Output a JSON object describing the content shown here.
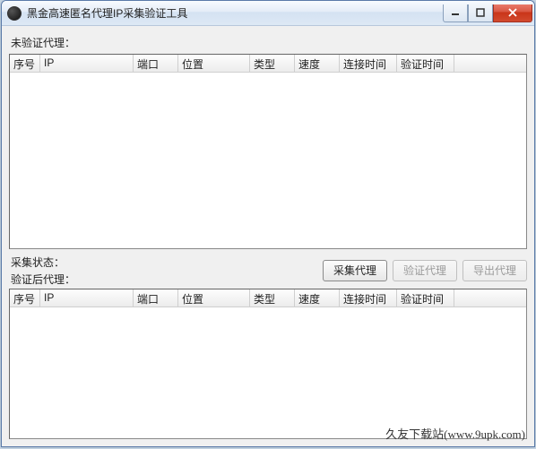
{
  "window": {
    "title": "黑金高速匿名代理IP采集验证工具"
  },
  "labels": {
    "unverified": "未验证代理：",
    "collect_status": "采集状态：",
    "verified": "验证后代理："
  },
  "columns": {
    "seq": "序号",
    "ip": "IP",
    "port": "端口",
    "location": "位置",
    "type": "类型",
    "speed": "速度",
    "connect_time": "连接时间",
    "verify_time": "验证时间"
  },
  "buttons": {
    "collect": "采集代理",
    "verify": "验证代理",
    "export": "导出代理"
  },
  "watermark": "久友下载站(www.9upk.com)"
}
